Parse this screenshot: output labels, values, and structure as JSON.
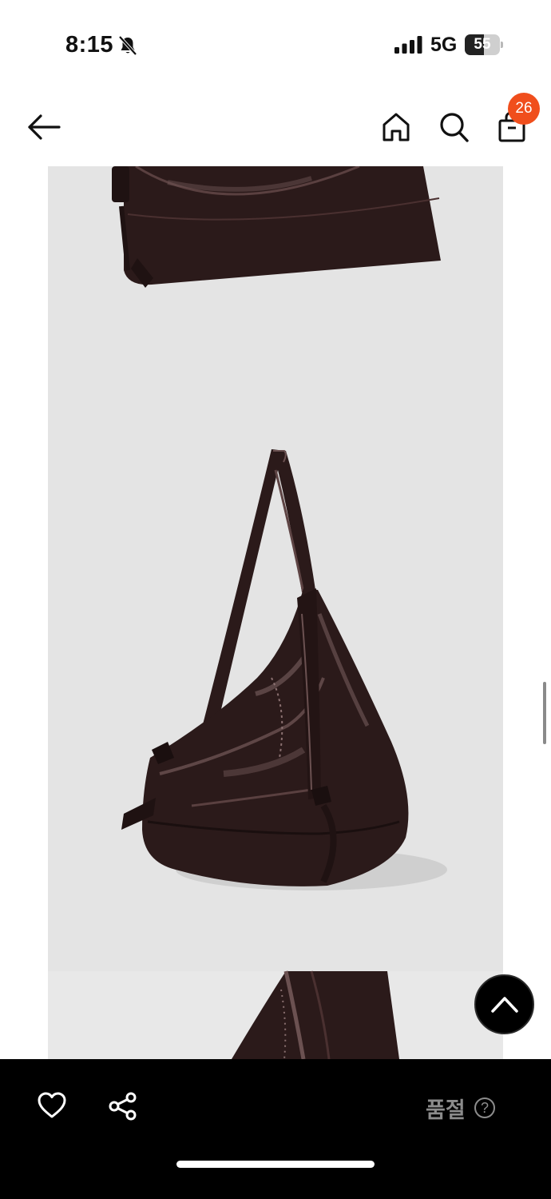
{
  "status_bar": {
    "time": "8:15",
    "network": "5G",
    "battery": {
      "label": "55",
      "level_percent": 55
    },
    "icons": [
      "bell-slash-icon",
      "signal-icon",
      "battery-icon"
    ]
  },
  "header": {
    "icons": [
      "arrow-left-icon",
      "home-icon",
      "search-icon",
      "shopping-bag-icon"
    ],
    "cart_count": "26",
    "badge_color": "#f04e1c"
  },
  "product_images": {
    "background": "#e4e4e4",
    "bag_color": "#2b1a1a",
    "images": [
      "bag-top-detail",
      "bag-shoulder-view",
      "bag-side-detail"
    ]
  },
  "bottom_bar": {
    "status_label": "품절",
    "help_symbol": "?",
    "icons": [
      "heart-icon",
      "share-icon",
      "help-circle-icon",
      "chevron-up-icon"
    ],
    "label_color": "#8c8c8c"
  }
}
